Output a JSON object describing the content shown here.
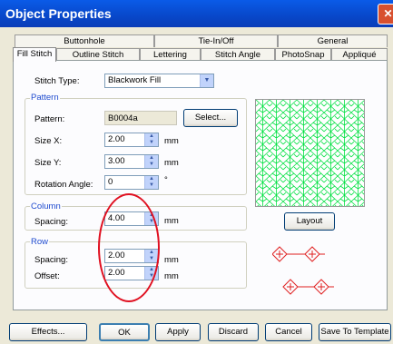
{
  "window": {
    "title": "Object Properties"
  },
  "tabs_back": [
    {
      "label": "Buttonhole"
    },
    {
      "label": "Tie-In/Off"
    },
    {
      "label": "General"
    }
  ],
  "tabs_front": [
    {
      "label": "Fill Stitch"
    },
    {
      "label": "Outline Stitch"
    },
    {
      "label": "Lettering"
    },
    {
      "label": "Stitch Angle"
    },
    {
      "label": "PhotoSnap"
    },
    {
      "label": "Appliqué"
    }
  ],
  "form": {
    "stitch_type_label": "Stitch Type:",
    "stitch_type_value": "Blackwork Fill",
    "pattern_group": "Pattern",
    "pattern_label": "Pattern:",
    "pattern_value": "B0004a",
    "select_button": "Select...",
    "size_x_label": "Size X:",
    "size_x_value": "2.00",
    "size_y_label": "Size Y:",
    "size_y_value": "3.00",
    "rotation_label": "Rotation Angle:",
    "rotation_value": "0",
    "column_group": "Column",
    "column_spacing_label": "Spacing:",
    "column_spacing_value": "4.00",
    "row_group": "Row",
    "row_spacing_label": "Spacing:",
    "row_spacing_value": "2.00",
    "row_offset_label": "Offset:",
    "row_offset_value": "2.00",
    "unit_mm": "mm",
    "unit_deg": "°",
    "layout_button": "Layout"
  },
  "buttons": {
    "effects": "Effects...",
    "ok": "OK",
    "apply": "Apply",
    "discard": "Discard",
    "cancel": "Cancel",
    "save_template": "Save To Template"
  },
  "colors": {
    "pattern_lines": "#00E040",
    "motif": "#E02020",
    "annotation": "#E01020",
    "titlebar": "#0A5BE8"
  },
  "icons": [
    "close-icon",
    "dropdown-arrow-icon",
    "spin-arrows-icon"
  ]
}
